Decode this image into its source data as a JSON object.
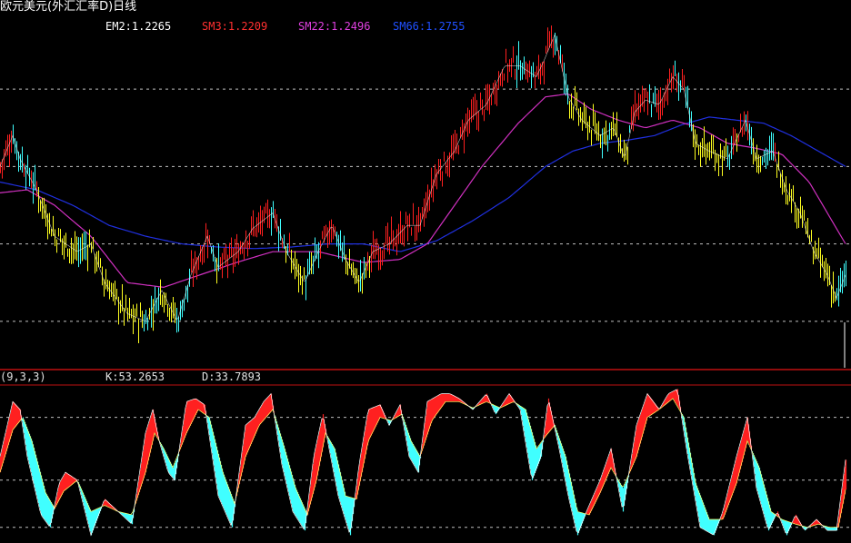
{
  "title": "欧元美元(外汇汇率D)日线",
  "ma_labels": [
    {
      "text": "EM2:1.2265",
      "color": "#ffffff"
    },
    {
      "text": "SM3:1.2209",
      "color": "#ff3030"
    },
    {
      "text": "SM22:1.2496",
      "color": "#e040e0"
    },
    {
      "text": "SM66:1.2755",
      "color": "#2050ff"
    }
  ],
  "kdj": {
    "name": "(9,3,3)",
    "k_label": "K:53.2653",
    "d_label": "D:33.7893"
  },
  "colors": {
    "up": "#ff2020",
    "down": "#ffff20",
    "cyan": "#40ffff",
    "ma22": "#d030c0",
    "ma66": "#2030e0",
    "grid": "#c0c0c0",
    "divider": "#c01010"
  },
  "chart_data": [
    {
      "type": "line",
      "title": "欧元美元(外汇汇率D)日线",
      "ylim": [
        1.17,
        1.39
      ],
      "grid": true,
      "anchors": [
        [
          0,
          1.3
        ],
        [
          14,
          1.32
        ],
        [
          22,
          1.305
        ],
        [
          40,
          1.285
        ],
        [
          60,
          1.255
        ],
        [
          85,
          1.245
        ],
        [
          100,
          1.25
        ],
        [
          115,
          1.225
        ],
        [
          140,
          1.205
        ],
        [
          160,
          1.2
        ],
        [
          178,
          1.22
        ],
        [
          195,
          1.2
        ],
        [
          210,
          1.23
        ],
        [
          228,
          1.255
        ],
        [
          240,
          1.235
        ],
        [
          262,
          1.245
        ],
        [
          278,
          1.26
        ],
        [
          300,
          1.27
        ],
        [
          315,
          1.245
        ],
        [
          335,
          1.225
        ],
        [
          350,
          1.245
        ],
        [
          365,
          1.262
        ],
        [
          380,
          1.24
        ],
        [
          395,
          1.225
        ],
        [
          410,
          1.245
        ],
        [
          428,
          1.25
        ],
        [
          448,
          1.262
        ],
        [
          462,
          1.262
        ],
        [
          480,
          1.295
        ],
        [
          500,
          1.31
        ],
        [
          515,
          1.33
        ],
        [
          535,
          1.34
        ],
        [
          555,
          1.365
        ],
        [
          572,
          1.365
        ],
        [
          590,
          1.358
        ],
        [
          598,
          1.368
        ],
        [
          610,
          1.385
        ],
        [
          625,
          1.345
        ],
        [
          640,
          1.33
        ],
        [
          660,
          1.32
        ],
        [
          675,
          1.325
        ],
        [
          687,
          1.305
        ],
        [
          698,
          1.335
        ],
        [
          710,
          1.343
        ],
        [
          725,
          1.34
        ],
        [
          740,
          1.358
        ],
        [
          752,
          1.35
        ],
        [
          765,
          1.315
        ],
        [
          780,
          1.31
        ],
        [
          800,
          1.305
        ],
        [
          820,
          1.33
        ],
        [
          832,
          1.305
        ],
        [
          850,
          1.31
        ],
        [
          865,
          1.285
        ],
        [
          880,
          1.27
        ],
        [
          895,
          1.245
        ],
        [
          910,
          1.23
        ],
        [
          920,
          1.215
        ],
        [
          930,
          1.23
        ]
      ],
      "ma22_anchors": [
        [
          0,
          1.283
        ],
        [
          30,
          1.285
        ],
        [
          60,
          1.275
        ],
        [
          100,
          1.255
        ],
        [
          140,
          1.225
        ],
        [
          180,
          1.222
        ],
        [
          220,
          1.23
        ],
        [
          260,
          1.238
        ],
        [
          300,
          1.245
        ],
        [
          350,
          1.245
        ],
        [
          400,
          1.238
        ],
        [
          440,
          1.24
        ],
        [
          470,
          1.25
        ],
        [
          500,
          1.275
        ],
        [
          530,
          1.3
        ],
        [
          570,
          1.328
        ],
        [
          600,
          1.345
        ],
        [
          625,
          1.347
        ],
        [
          650,
          1.337
        ],
        [
          680,
          1.33
        ],
        [
          710,
          1.325
        ],
        [
          740,
          1.33
        ],
        [
          770,
          1.325
        ],
        [
          800,
          1.315
        ],
        [
          830,
          1.312
        ],
        [
          860,
          1.308
        ],
        [
          890,
          1.29
        ],
        [
          915,
          1.265
        ],
        [
          930,
          1.25
        ]
      ],
      "ma66_anchors": [
        [
          0,
          1.29
        ],
        [
          40,
          1.285
        ],
        [
          80,
          1.275
        ],
        [
          120,
          1.262
        ],
        [
          160,
          1.255
        ],
        [
          200,
          1.25
        ],
        [
          240,
          1.248
        ],
        [
          280,
          1.247
        ],
        [
          320,
          1.248
        ],
        [
          360,
          1.25
        ],
        [
          400,
          1.25
        ],
        [
          440,
          1.245
        ],
        [
          480,
          1.252
        ],
        [
          520,
          1.265
        ],
        [
          560,
          1.28
        ],
        [
          600,
          1.3
        ],
        [
          630,
          1.31
        ],
        [
          660,
          1.315
        ],
        [
          690,
          1.317
        ],
        [
          720,
          1.32
        ],
        [
          750,
          1.327
        ],
        [
          780,
          1.332
        ],
        [
          810,
          1.33
        ],
        [
          840,
          1.328
        ],
        [
          870,
          1.32
        ],
        [
          900,
          1.31
        ],
        [
          930,
          1.3
        ]
      ]
    },
    {
      "type": "area",
      "title": "(9,3,3)",
      "ylim": [
        0,
        100
      ],
      "kpoints": [
        [
          0,
          55
        ],
        [
          14,
          90
        ],
        [
          22,
          85
        ],
        [
          30,
          55
        ],
        [
          45,
          18
        ],
        [
          55,
          10
        ],
        [
          65,
          38
        ],
        [
          72,
          45
        ],
        [
          85,
          40
        ],
        [
          100,
          5
        ],
        [
          115,
          28
        ],
        [
          130,
          20
        ],
        [
          145,
          12
        ],
        [
          160,
          70
        ],
        [
          168,
          85
        ],
        [
          175,
          65
        ],
        [
          185,
          45
        ],
        [
          192,
          40
        ],
        [
          205,
          90
        ],
        [
          215,
          92
        ],
        [
          225,
          88
        ],
        [
          240,
          30
        ],
        [
          255,
          10
        ],
        [
          270,
          75
        ],
        [
          280,
          80
        ],
        [
          290,
          90
        ],
        [
          298,
          95
        ],
        [
          310,
          50
        ],
        [
          322,
          20
        ],
        [
          335,
          8
        ],
        [
          345,
          55
        ],
        [
          355,
          82
        ],
        [
          362,
          60
        ],
        [
          372,
          30
        ],
        [
          385,
          5
        ],
        [
          395,
          50
        ],
        [
          405,
          85
        ],
        [
          418,
          88
        ],
        [
          428,
          75
        ],
        [
          440,
          88
        ],
        [
          450,
          55
        ],
        [
          460,
          45
        ],
        [
          470,
          90
        ],
        [
          485,
          95
        ],
        [
          495,
          95
        ],
        [
          505,
          92
        ],
        [
          520,
          85
        ],
        [
          535,
          95
        ],
        [
          545,
          82
        ],
        [
          560,
          95
        ],
        [
          572,
          85
        ],
        [
          585,
          40
        ],
        [
          595,
          55
        ],
        [
          603,
          92
        ],
        [
          615,
          60
        ],
        [
          625,
          30
        ],
        [
          635,
          5
        ],
        [
          645,
          20
        ],
        [
          660,
          40
        ],
        [
          672,
          60
        ],
        [
          685,
          20
        ],
        [
          700,
          75
        ],
        [
          712,
          95
        ],
        [
          725,
          85
        ],
        [
          735,
          95
        ],
        [
          745,
          98
        ],
        [
          755,
          60
        ],
        [
          770,
          10
        ],
        [
          785,
          5
        ],
        [
          795,
          20
        ],
        [
          810,
          55
        ],
        [
          822,
          80
        ],
        [
          832,
          35
        ],
        [
          845,
          8
        ],
        [
          855,
          20
        ],
        [
          865,
          5
        ],
        [
          875,
          18
        ],
        [
          885,
          8
        ],
        [
          898,
          15
        ],
        [
          910,
          8
        ],
        [
          920,
          8
        ],
        [
          930,
          53
        ]
      ],
      "dpoints": [
        [
          0,
          45
        ],
        [
          14,
          72
        ],
        [
          25,
          80
        ],
        [
          35,
          65
        ],
        [
          50,
          32
        ],
        [
          60,
          22
        ],
        [
          70,
          33
        ],
        [
          85,
          40
        ],
        [
          100,
          20
        ],
        [
          115,
          24
        ],
        [
          130,
          20
        ],
        [
          145,
          18
        ],
        [
          160,
          45
        ],
        [
          170,
          70
        ],
        [
          180,
          60
        ],
        [
          190,
          48
        ],
        [
          205,
          70
        ],
        [
          218,
          85
        ],
        [
          230,
          80
        ],
        [
          245,
          45
        ],
        [
          258,
          25
        ],
        [
          270,
          55
        ],
        [
          285,
          75
        ],
        [
          300,
          85
        ],
        [
          312,
          62
        ],
        [
          325,
          35
        ],
        [
          338,
          18
        ],
        [
          348,
          40
        ],
        [
          358,
          70
        ],
        [
          368,
          60
        ],
        [
          380,
          30
        ],
        [
          392,
          28
        ],
        [
          405,
          65
        ],
        [
          418,
          80
        ],
        [
          430,
          78
        ],
        [
          442,
          82
        ],
        [
          452,
          65
        ],
        [
          462,
          55
        ],
        [
          475,
          78
        ],
        [
          490,
          90
        ],
        [
          505,
          90
        ],
        [
          520,
          86
        ],
        [
          535,
          90
        ],
        [
          550,
          86
        ],
        [
          565,
          90
        ],
        [
          578,
          85
        ],
        [
          590,
          60
        ],
        [
          600,
          68
        ],
        [
          610,
          75
        ],
        [
          622,
          55
        ],
        [
          635,
          20
        ],
        [
          648,
          18
        ],
        [
          660,
          32
        ],
        [
          672,
          48
        ],
        [
          685,
          35
        ],
        [
          700,
          55
        ],
        [
          712,
          80
        ],
        [
          725,
          85
        ],
        [
          740,
          92
        ],
        [
          752,
          80
        ],
        [
          765,
          38
        ],
        [
          780,
          15
        ],
        [
          795,
          15
        ],
        [
          810,
          38
        ],
        [
          822,
          65
        ],
        [
          835,
          48
        ],
        [
          848,
          20
        ],
        [
          860,
          15
        ],
        [
          875,
          12
        ],
        [
          888,
          10
        ],
        [
          900,
          12
        ],
        [
          912,
          10
        ],
        [
          922,
          10
        ],
        [
          930,
          34
        ]
      ]
    }
  ]
}
